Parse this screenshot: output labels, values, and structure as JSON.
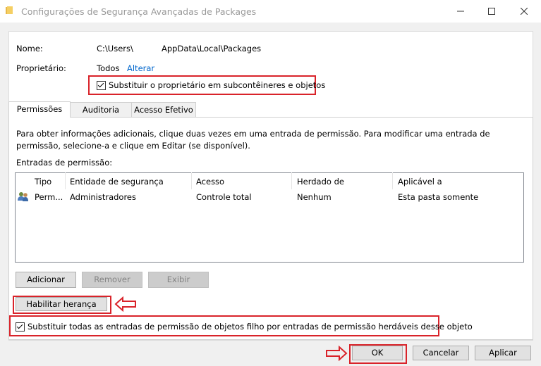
{
  "window": {
    "title": "Configurações de Segurança Avançadas de Packages"
  },
  "info": {
    "name_label": "Nome:",
    "name_value_a": "C:\\Users\\",
    "name_value_b": "AppData\\Local\\Packages",
    "owner_label": "Proprietário:",
    "owner_value": "Todos",
    "change_link": "Alterar",
    "replace_owner_label": "Substituir o proprietário em subcontêineres e objetos",
    "replace_owner_checked": true
  },
  "tabs": [
    {
      "label": "Permissões",
      "active": true
    },
    {
      "label": "Auditoria",
      "active": false
    },
    {
      "label": "Acesso Efetivo",
      "active": false
    }
  ],
  "description": "Para obter informações adicionais, clique duas vezes em uma entrada de permissão. Para modificar uma entrada de permissão, selecione-a e clique em Editar (se disponível).",
  "entries_label": "Entradas de permissão:",
  "columns": [
    "Tipo",
    "Entidade de segurança",
    "Acesso",
    "Herdado de",
    "Aplicável a"
  ],
  "rows": [
    {
      "type": "Perm...",
      "principal": "Administradores",
      "access": "Controle total",
      "inherited": "Nenhum",
      "applies": "Esta pasta somente",
      "icon": "users-icon"
    }
  ],
  "buttons": {
    "add": "Adicionar",
    "remove": "Remover",
    "view": "Exibir",
    "enable_inheritance": "Habilitar herança",
    "replace_all_label": "Substituir todas as entradas de permissão de objetos filho por entradas de permissão herdáveis desse objeto",
    "replace_all_checked": true,
    "ok": "OK",
    "cancel": "Cancelar",
    "apply": "Aplicar"
  },
  "colors": {
    "highlight": "#d9232a",
    "link": "#0066cc",
    "disabled_button": "#cccccc"
  }
}
